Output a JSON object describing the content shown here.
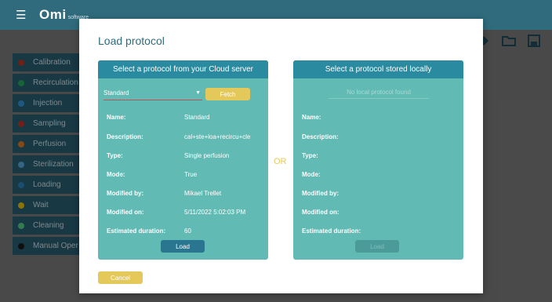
{
  "app": {
    "logo_text": "Omi",
    "logo_subtext": "software"
  },
  "toolbar": {
    "icons": [
      "tag-icon",
      "folder-icon",
      "save-icon"
    ]
  },
  "sidebar": {
    "items": [
      {
        "label": "Calibration",
        "icon": "calibration-icon",
        "color": "#c0392b"
      },
      {
        "label": "Recirculation",
        "icon": "recirculation-icon",
        "color": "#27ae60"
      },
      {
        "label": "Injection",
        "icon": "injection-icon",
        "color": "#3498db"
      },
      {
        "label": "Sampling",
        "icon": "sampling-icon",
        "color": "#c0392b"
      },
      {
        "label": "Perfusion",
        "icon": "perfusion-icon",
        "color": "#e67e22"
      },
      {
        "label": "Sterilization",
        "icon": "sterilization-icon",
        "color": "#5dade2"
      },
      {
        "label": "Loading",
        "icon": "loading-icon",
        "color": "#2e86c1"
      },
      {
        "label": "Wait",
        "icon": "hourglass-icon",
        "color": "#f1c40f"
      },
      {
        "label": "Cleaning",
        "icon": "cleaning-icon",
        "color": "#58d68d"
      },
      {
        "label": "Manual Oper",
        "icon": "manual-icon",
        "color": "#1b1b1b"
      }
    ]
  },
  "modal": {
    "title": "Load protocol",
    "or_text": "OR",
    "cancel_label": "Cancel",
    "cloud": {
      "header": "Select a protocol from your Cloud server",
      "selected_protocol": "Standard",
      "fetch_label": "Fetch",
      "load_label": "Load",
      "fields": [
        {
          "label": "Name:",
          "value": "Standard"
        },
        {
          "label": "Description:",
          "value": "cal+ste+loa+recircu+cle"
        },
        {
          "label": "Type:",
          "value": "Single perfusion"
        },
        {
          "label": "Mode:",
          "value": "True"
        },
        {
          "label": "Modified by:",
          "value": "Mikael Trellet"
        },
        {
          "label": "Modified on:",
          "value": "5/11/2022 5:02:03 PM"
        },
        {
          "label": "Estimated duration:",
          "value": "60"
        }
      ]
    },
    "local": {
      "header": "Select a protocol stored locally",
      "placeholder": "No local protocol found",
      "load_label": "Load",
      "fields": [
        {
          "label": "Name:"
        },
        {
          "label": "Description:"
        },
        {
          "label": "Type:"
        },
        {
          "label": "Mode:"
        },
        {
          "label": "Modified by:"
        },
        {
          "label": "Modified on:"
        },
        {
          "label": "Estimated duration:"
        }
      ]
    }
  },
  "colors": {
    "header": "#2f6b7c",
    "panel": "#61bbb4",
    "panel_header": "#2a8aa0",
    "accent_yellow": "#e5c85a",
    "load_button": "#2a7590"
  }
}
